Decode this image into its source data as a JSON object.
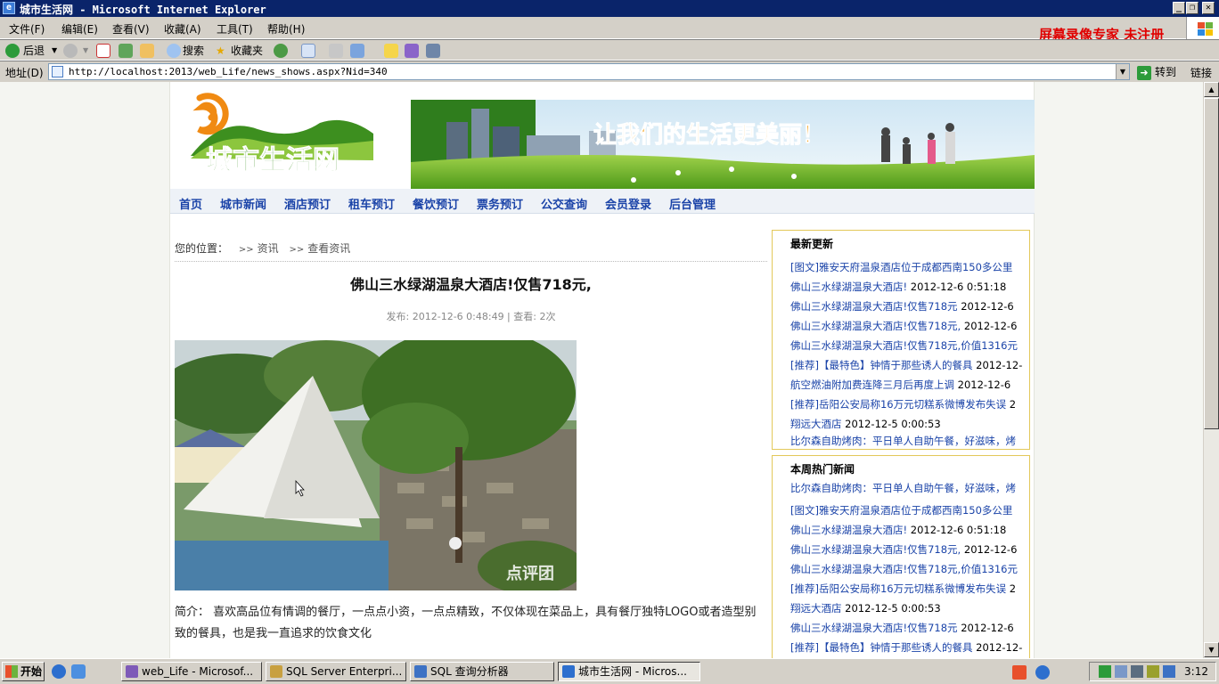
{
  "window": {
    "title": "城市生活网 - Microsoft Internet Explorer",
    "watermark": "屏幕录像专家  未注册"
  },
  "menu": [
    "文件(F)",
    "编辑(E)",
    "查看(V)",
    "收藏(A)",
    "工具(T)",
    "帮助(H)"
  ],
  "toolbar": {
    "back_label": "后退",
    "search_label": "搜索",
    "favorites_label": "收藏夹"
  },
  "address": {
    "label": "地址(D)",
    "url": "http://localhost:2013/web_Life/news_shows.aspx?Nid=340",
    "go_label": "转到",
    "links_label": "链接"
  },
  "site": {
    "logo_text": "城市生活网",
    "banner_slogan": "让我们的生活更美丽！",
    "nav": [
      "首页",
      "城市新闻",
      "酒店预订",
      "租车预订",
      "餐饮预订",
      "票务预订",
      "公交查询",
      "会员登录",
      "后台管理"
    ]
  },
  "breadcrumb": {
    "label": "您的位置：",
    "items": [
      "资讯",
      "查看资讯"
    ]
  },
  "article": {
    "title": "佛山三水绿湖温泉大酒店!仅售718元,",
    "meta": "发布: 2012-12-6 0:48:49  |  查看: 2次",
    "photo_watermark": "点评团",
    "summary": "简介：  喜欢高品位有情调的餐厅，一点点小资，一点点精致，不仅体现在菜品上，具有餐厅独特LOGO或者造型别致的餐具，也是我一直追求的饮食文化"
  },
  "latest": {
    "title": "最新更新",
    "items": [
      {
        "text": "[图文]雅安天府温泉酒店位于成都西南150多公里",
        "date": ""
      },
      {
        "text": "佛山三水绿湖温泉大酒店!",
        "date": "2012-12-6 0:51:18"
      },
      {
        "text": "佛山三水绿湖温泉大酒店!仅售718元",
        "date": "2012-12-6"
      },
      {
        "text": "佛山三水绿湖温泉大酒店!仅售718元,",
        "date": "2012-12-6"
      },
      {
        "text": "佛山三水绿湖温泉大酒店!仅售718元,价值1316元",
        "date": ""
      },
      {
        "text": "[推荐]【最特色】钟情于那些诱人的餐具",
        "date": "2012-12-"
      },
      {
        "text": "航空燃油附加费连降三月后再度上调",
        "date": "2012-12-6"
      },
      {
        "text": "[推荐]岳阳公安局称16万元切糕系微博发布失误",
        "date": "2"
      },
      {
        "text": "翔远大酒店",
        "date": "2012-12-5 0:00:53"
      },
      {
        "text": "比尔森自助烤肉：平日单人自助午餐，好滋味，烤",
        "date": ""
      }
    ]
  },
  "hot": {
    "title": "本周热门新闻",
    "items": [
      {
        "text": "比尔森自助烤肉：平日单人自助午餐，好滋味，烤",
        "date": ""
      },
      {
        "text": "[图文]雅安天府温泉酒店位于成都西南150多公里",
        "date": ""
      },
      {
        "text": "佛山三水绿湖温泉大酒店!",
        "date": "2012-12-6 0:51:18"
      },
      {
        "text": "佛山三水绿湖温泉大酒店!仅售718元,",
        "date": "2012-12-6"
      },
      {
        "text": "佛山三水绿湖温泉大酒店!仅售718元,价值1316元",
        "date": ""
      },
      {
        "text": "[推荐]岳阳公安局称16万元切糕系微博发布失误",
        "date": "2"
      },
      {
        "text": "翔远大酒店",
        "date": "2012-12-5 0:00:53"
      },
      {
        "text": "佛山三水绿湖温泉大酒店!仅售718元",
        "date": "2012-12-6"
      },
      {
        "text": "[推荐]【最特色】钟情于那些诱人的餐具",
        "date": "2012-12-"
      }
    ]
  },
  "taskbar": {
    "start_label": "开始",
    "tasks": [
      "web_Life - Microsof...",
      "SQL Server Enterpri...",
      "SQL 查询分析器",
      "城市生活网 - Micros..."
    ],
    "clock": "3:12"
  }
}
